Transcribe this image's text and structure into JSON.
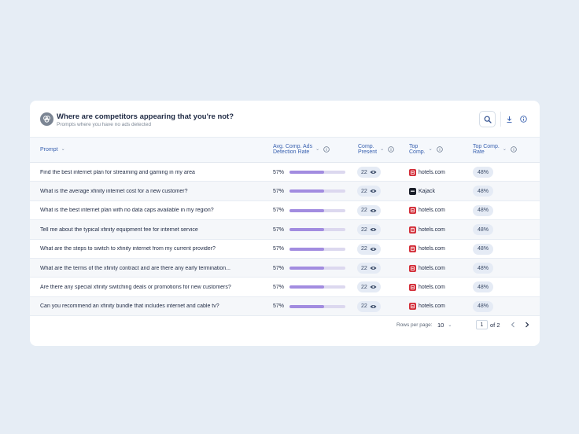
{
  "header": {
    "title": "Where are competitors appearing that you're not?",
    "subtitle": "Prompts where you have no ads detected",
    "icon": "competitor-rings-icon"
  },
  "columns": [
    {
      "key": "prompt",
      "label_line1": "Prompt",
      "label_line2": ""
    },
    {
      "key": "rate",
      "label_line1": "Avg. Comp. Ads",
      "label_line2": "Detection Rate"
    },
    {
      "key": "present",
      "label_line1": "Comp.",
      "label_line2": "Present"
    },
    {
      "key": "top_comp",
      "label_line1": "Top",
      "label_line2": "Comp."
    },
    {
      "key": "top_rate",
      "label_line1": "Top Comp.",
      "label_line2": "Rate"
    }
  ],
  "rows": [
    {
      "prompt": "Find the best internet plan for streaming and gaming in my area",
      "rate": "57%",
      "rate_fraction": 0.62,
      "present": "22",
      "top_comp": "hotels.com",
      "top_comp_logo": "hotels",
      "top_rate": "48%"
    },
    {
      "prompt": "What is the average xfinity internet cost for a new customer?",
      "rate": "57%",
      "rate_fraction": 0.62,
      "present": "22",
      "top_comp": "Kajack",
      "top_comp_logo": "kajack",
      "top_rate": "48%"
    },
    {
      "prompt": "What is the best internet plan with no data caps available in my region?",
      "rate": "57%",
      "rate_fraction": 0.62,
      "present": "22",
      "top_comp": "hotels.com",
      "top_comp_logo": "hotels",
      "top_rate": "48%"
    },
    {
      "prompt": "Tell me about the typical xfinity equipment fee for internet service",
      "rate": "57%",
      "rate_fraction": 0.62,
      "present": "22",
      "top_comp": "hotels.com",
      "top_comp_logo": "hotels",
      "top_rate": "48%"
    },
    {
      "prompt": "What are the steps to switch to xfinity internet from my current provider?",
      "rate": "57%",
      "rate_fraction": 0.62,
      "present": "22",
      "top_comp": "hotels.com",
      "top_comp_logo": "hotels",
      "top_rate": "48%"
    },
    {
      "prompt": "What are the terms of the xfinity contract and are there any early termination...",
      "rate": "57%",
      "rate_fraction": 0.62,
      "present": "22",
      "top_comp": "hotels.com",
      "top_comp_logo": "hotels",
      "top_rate": "48%"
    },
    {
      "prompt": "Are there any special xfinity switching deals or promotions for new customers?",
      "rate": "57%",
      "rate_fraction": 0.62,
      "present": "22",
      "top_comp": "hotels.com",
      "top_comp_logo": "hotels",
      "top_rate": "48%"
    },
    {
      "prompt": "Can you recommend an xfinity bundle that includes internet and cable tv?",
      "rate": "57%",
      "rate_fraction": 0.62,
      "present": "22",
      "top_comp": "hotels.com",
      "top_comp_logo": "hotels",
      "top_rate": "48%"
    }
  ],
  "footer": {
    "rows_per_page_label": "Rows per page:",
    "rows_per_page_value": "10",
    "current_page": "1",
    "of_pages": "of 2"
  },
  "colors": {
    "bar_fill": "#a28ce0",
    "bar_track": "#dcd8ef",
    "header_text": "#3a62b0",
    "hotels_logo": "#d32f3a",
    "kajack_logo": "#1b1f2a"
  }
}
